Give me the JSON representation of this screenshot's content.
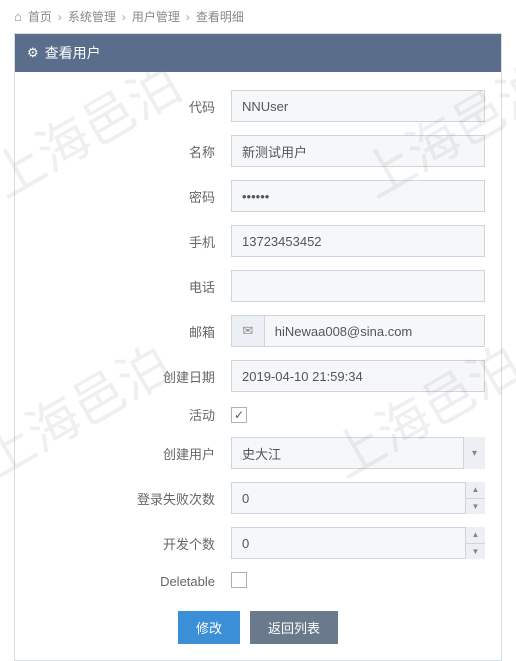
{
  "watermark": "上海邑泊",
  "breadcrumb": {
    "home": "首页",
    "sys": "系统管理",
    "user": "用户管理",
    "detail": "查看明细"
  },
  "panel": {
    "title": "查看用户"
  },
  "form": {
    "code_label": "代码",
    "code_value": "NNUser",
    "name_label": "名称",
    "name_value": "新测试用户",
    "password_label": "密码",
    "password_value": "••••••",
    "mobile_label": "手机",
    "mobile_value": "13723453452",
    "phone_label": "电话",
    "phone_value": "",
    "email_label": "邮箱",
    "email_value": "hiNewaa008@sina.com",
    "create_date_label": "创建日期",
    "create_date_value": "2019-04-10 21:59:34",
    "active_label": "活动",
    "active_checked": true,
    "create_user_label": "创建用户",
    "create_user_value": "史大江",
    "login_fail_label": "登录失败次数",
    "login_fail_value": "0",
    "dev_count_label": "开发个数",
    "dev_count_value": "0",
    "deletable_label": "Deletable",
    "deletable_checked": false
  },
  "actions": {
    "modify": "修改",
    "back": "返回列表"
  }
}
